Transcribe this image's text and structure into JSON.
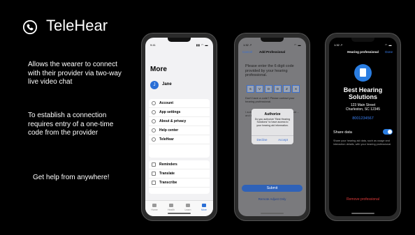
{
  "slide": {
    "title": "TeleHear",
    "logo_icon": "phone-circle-icon",
    "desc1": "Allows the wearer to connect with their provider via two-way live video chat",
    "desc2": "To establish a connection requires entry of a one-time code from the provider",
    "desc3": "Get help from anywhere!"
  },
  "phone1": {
    "time": "9:41",
    "status_icons": "▮▮ ◠ ▬",
    "heading": "More",
    "avatar_letter": "J",
    "user_name": "Jane",
    "menu": [
      {
        "label": "Account",
        "icon": "person-icon"
      },
      {
        "label": "App settings",
        "icon": "gear-icon"
      },
      {
        "label": "About & privacy",
        "icon": "info-icon"
      },
      {
        "label": "Help center",
        "icon": "question-icon"
      },
      {
        "label": "TeleHear",
        "icon": "phone-icon"
      }
    ],
    "menu2": [
      {
        "label": "Reminders",
        "icon": "calendar-icon"
      },
      {
        "label": "Translate",
        "icon": "translate-icon"
      },
      {
        "label": "Transcribe",
        "icon": "transcribe-icon"
      }
    ],
    "tabs": [
      "Home",
      "Health",
      "Learn",
      "More"
    ]
  },
  "phone2": {
    "time": "1:32 ↗",
    "status_icons": "◠ ▬",
    "cancel": "Cancel",
    "nav_title": "Add Professional",
    "instruction": "Please enter the 6 digit code provided by your hearing professional.",
    "code": [
      "6",
      "V",
      "D",
      "D",
      "Z",
      "X"
    ],
    "no_code": "Don't have a code? Please contact your hearing professional.",
    "bg_text": "I authorize ... access to my ... hearing aid ... and interaction details.",
    "dialog_title": "Authorize",
    "dialog_body": "Do you authorize \"Best Hearing Solutions\" to have access to your hearing aid information.",
    "decline": "Decline",
    "accept": "Accept",
    "submit": "Submit",
    "remote": "Remote Adjust Only"
  },
  "phone3": {
    "time": "1:32 ↗",
    "status_icons": "◠ ▬",
    "nav_title": "Hearing professional",
    "done": "Done",
    "provider": "Best Hearing Solutions",
    "address1": "123 Main Street",
    "address2": "Charleston, SC 12345",
    "phone": "8001234567",
    "share_label": "Share data",
    "share_on": true,
    "share_desc": "Share your hearing aid data, such as usage and interaction details, with your hearing professional.",
    "remove": "Remove professional"
  },
  "colors": {
    "accent": "#2a6fd6",
    "danger": "#e23b3b",
    "background": "#000000"
  }
}
